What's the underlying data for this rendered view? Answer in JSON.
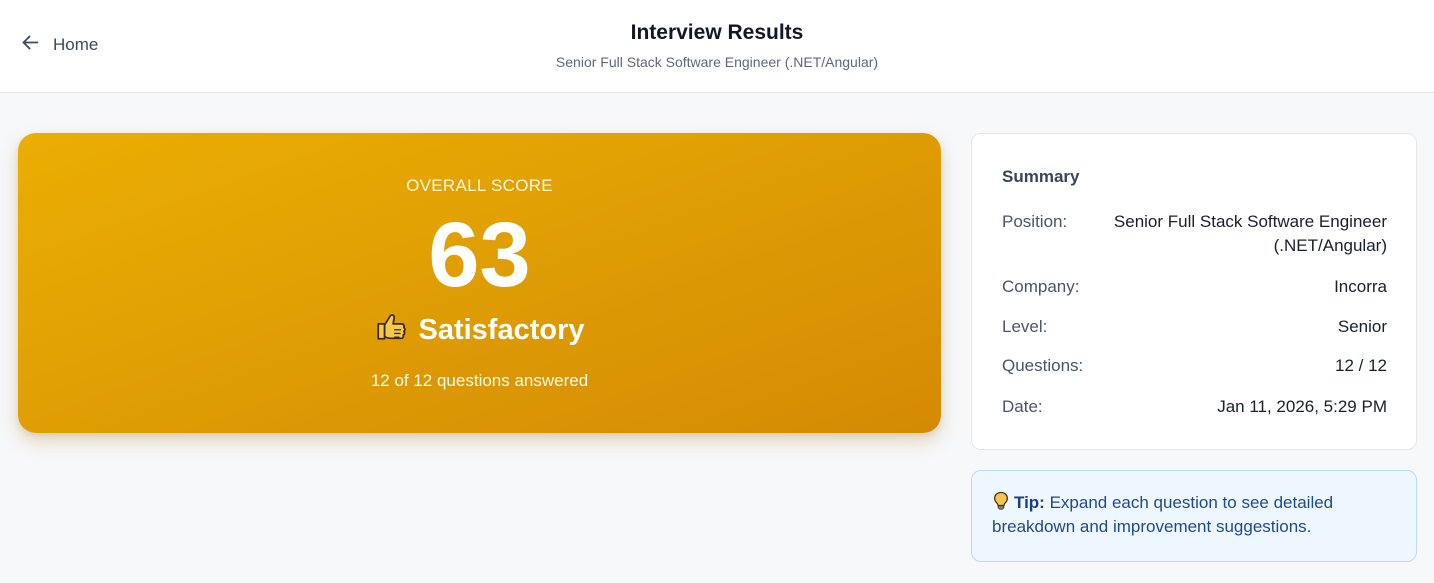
{
  "header": {
    "back_label": "Home",
    "title": "Interview Results",
    "subtitle": "Senior Full Stack Software Engineer (.NET/Angular)"
  },
  "score": {
    "label": "OVERALL SCORE",
    "value": "63",
    "rating": "Satisfactory",
    "rating_icon": "thumbs-up-icon",
    "answered": "12 of 12 questions answered",
    "color": "#e3a204"
  },
  "summary": {
    "title": "Summary",
    "rows": [
      {
        "key": "Position:",
        "value": "Senior Full Stack Software Engineer (.NET/Angular)"
      },
      {
        "key": "Company:",
        "value": "Incorra"
      },
      {
        "key": "Level:",
        "value": "Senior"
      },
      {
        "key": "Questions:",
        "value": "12 / 12"
      },
      {
        "key": "Date:",
        "value": "Jan 11, 2026, 5:29 PM"
      }
    ]
  },
  "tip": {
    "icon": "lightbulb-icon",
    "label": "Tip:",
    "text": "Expand each question to see detailed breakdown and improvement suggestions."
  }
}
